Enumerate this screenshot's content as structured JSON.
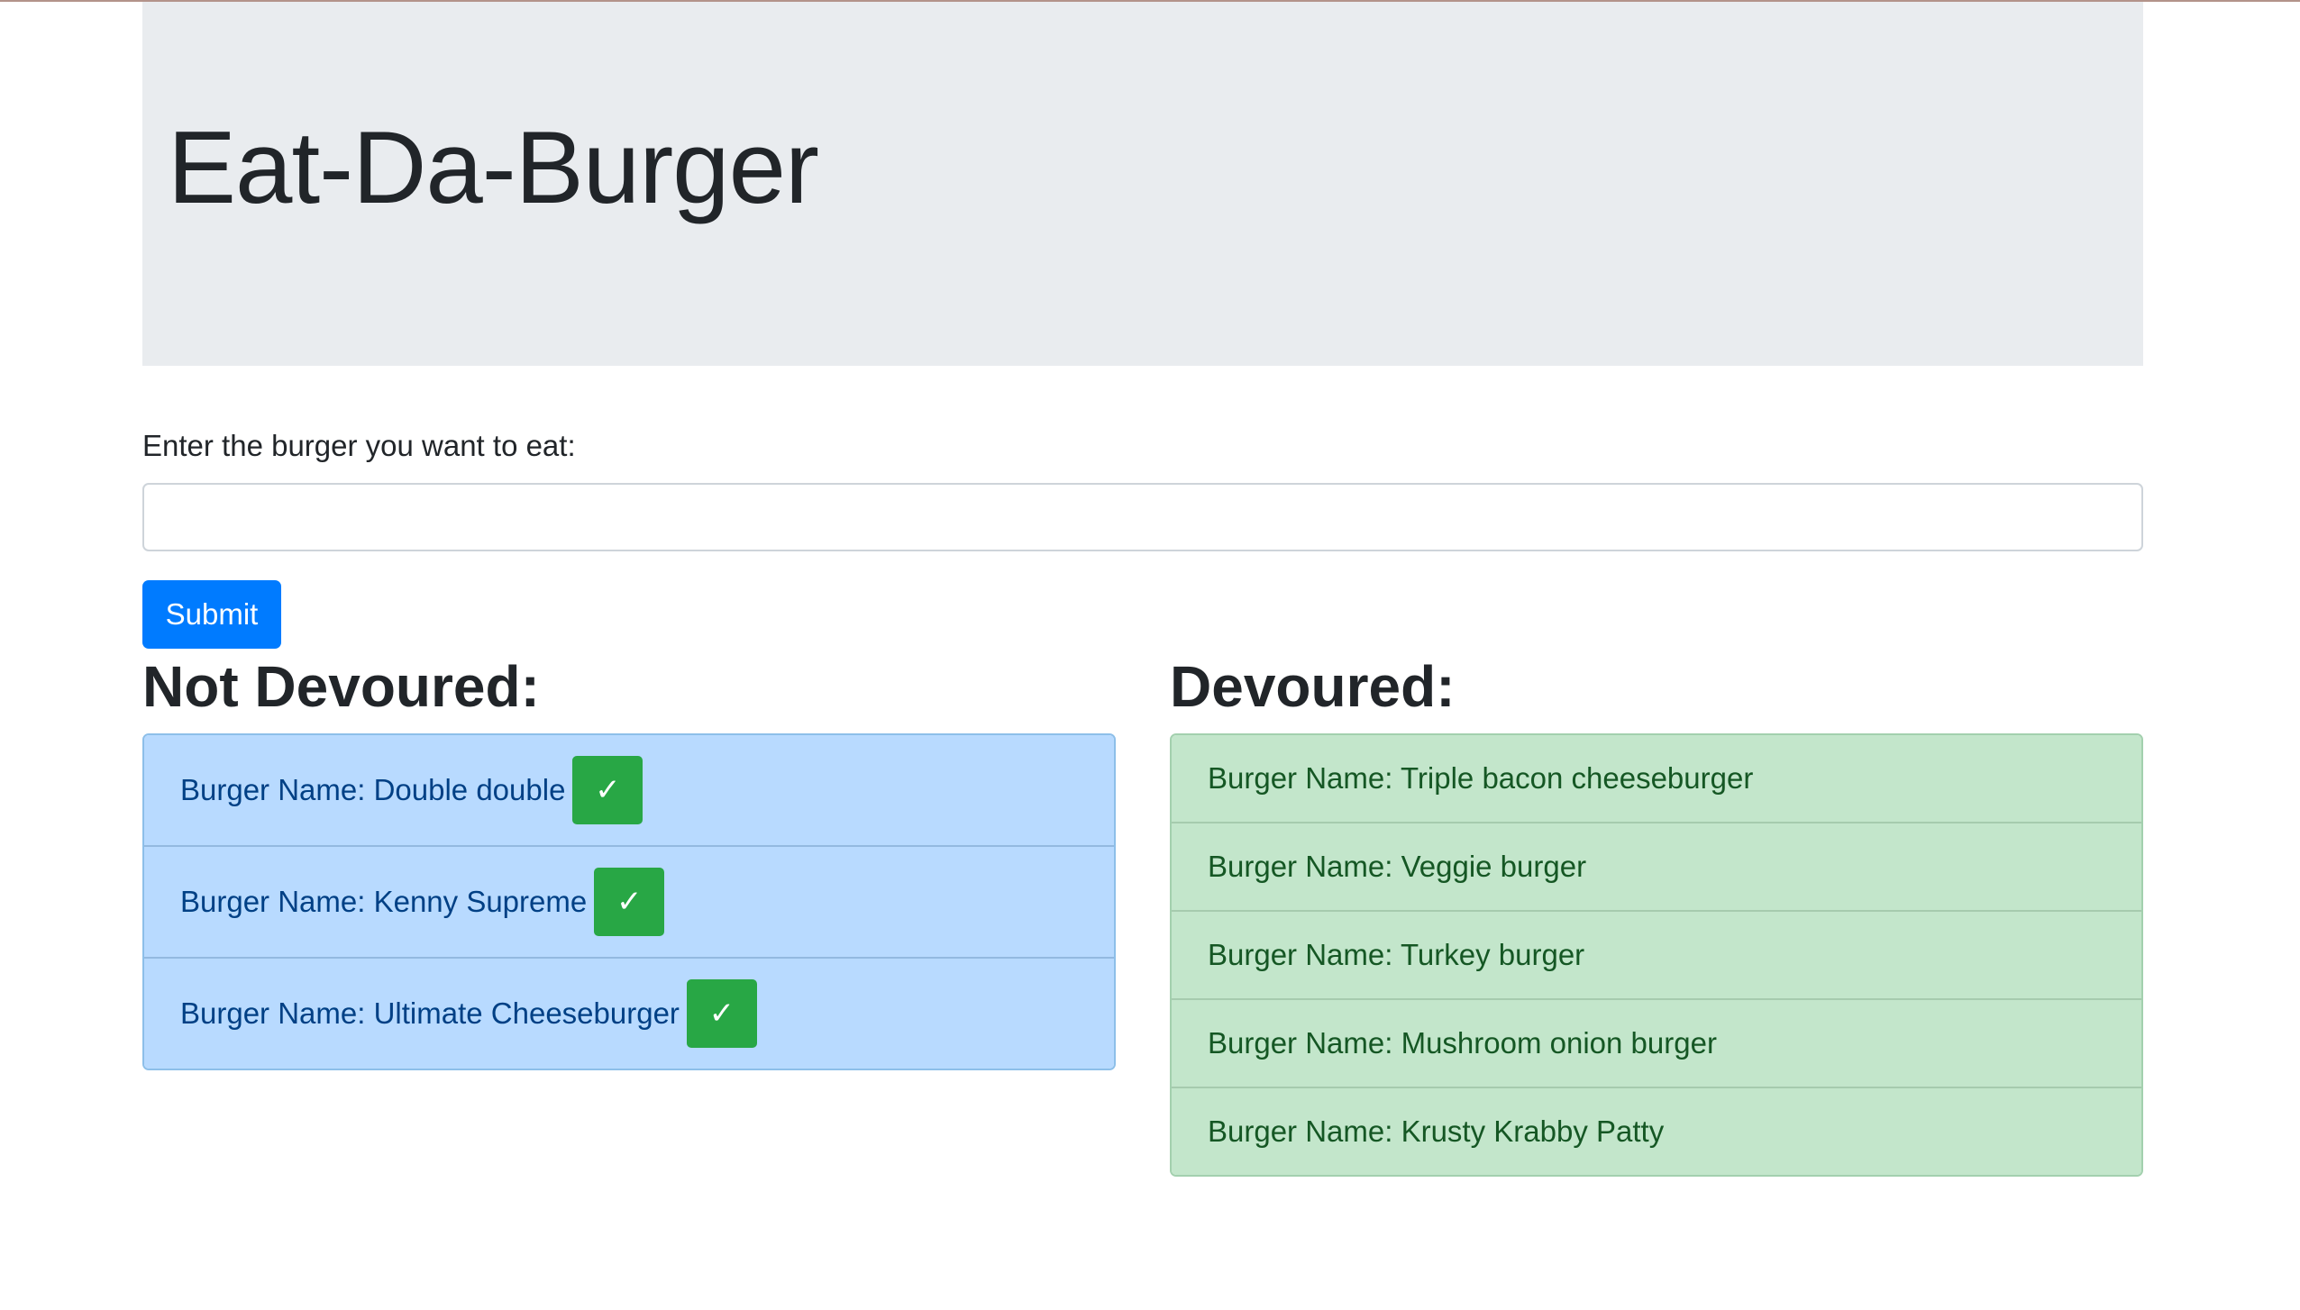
{
  "header": {
    "title": "Eat-Da-Burger"
  },
  "form": {
    "label": "Enter the burger you want to eat:",
    "input_value": "",
    "input_placeholder": "",
    "submit_label": "Submit"
  },
  "not_devoured": {
    "heading": "Not Devoured:",
    "items": [
      {
        "label": "Burger Name: Double double",
        "button_glyph": "✓"
      },
      {
        "label": "Burger Name: Kenny Supreme",
        "button_glyph": "✓"
      },
      {
        "label": "Burger Name: Ultimate Cheeseburger",
        "button_glyph": "✓"
      }
    ]
  },
  "devoured": {
    "heading": "Devoured:",
    "items": [
      {
        "label": "Burger Name: Triple bacon cheeseburger"
      },
      {
        "label": "Burger Name: Veggie burger"
      },
      {
        "label": "Burger Name: Turkey burger"
      },
      {
        "label": "Burger Name: Mushroom onion burger"
      },
      {
        "label": "Burger Name: Krusty Krabby Patty"
      }
    ]
  },
  "colors": {
    "primary": "#007bff",
    "success": "#28a745",
    "jumbotron_bg": "#e9ecef",
    "list_primary_bg": "#b8daff",
    "list_success_bg": "#c3e6cb"
  },
  "icons": {
    "devour_button": "check-icon"
  }
}
